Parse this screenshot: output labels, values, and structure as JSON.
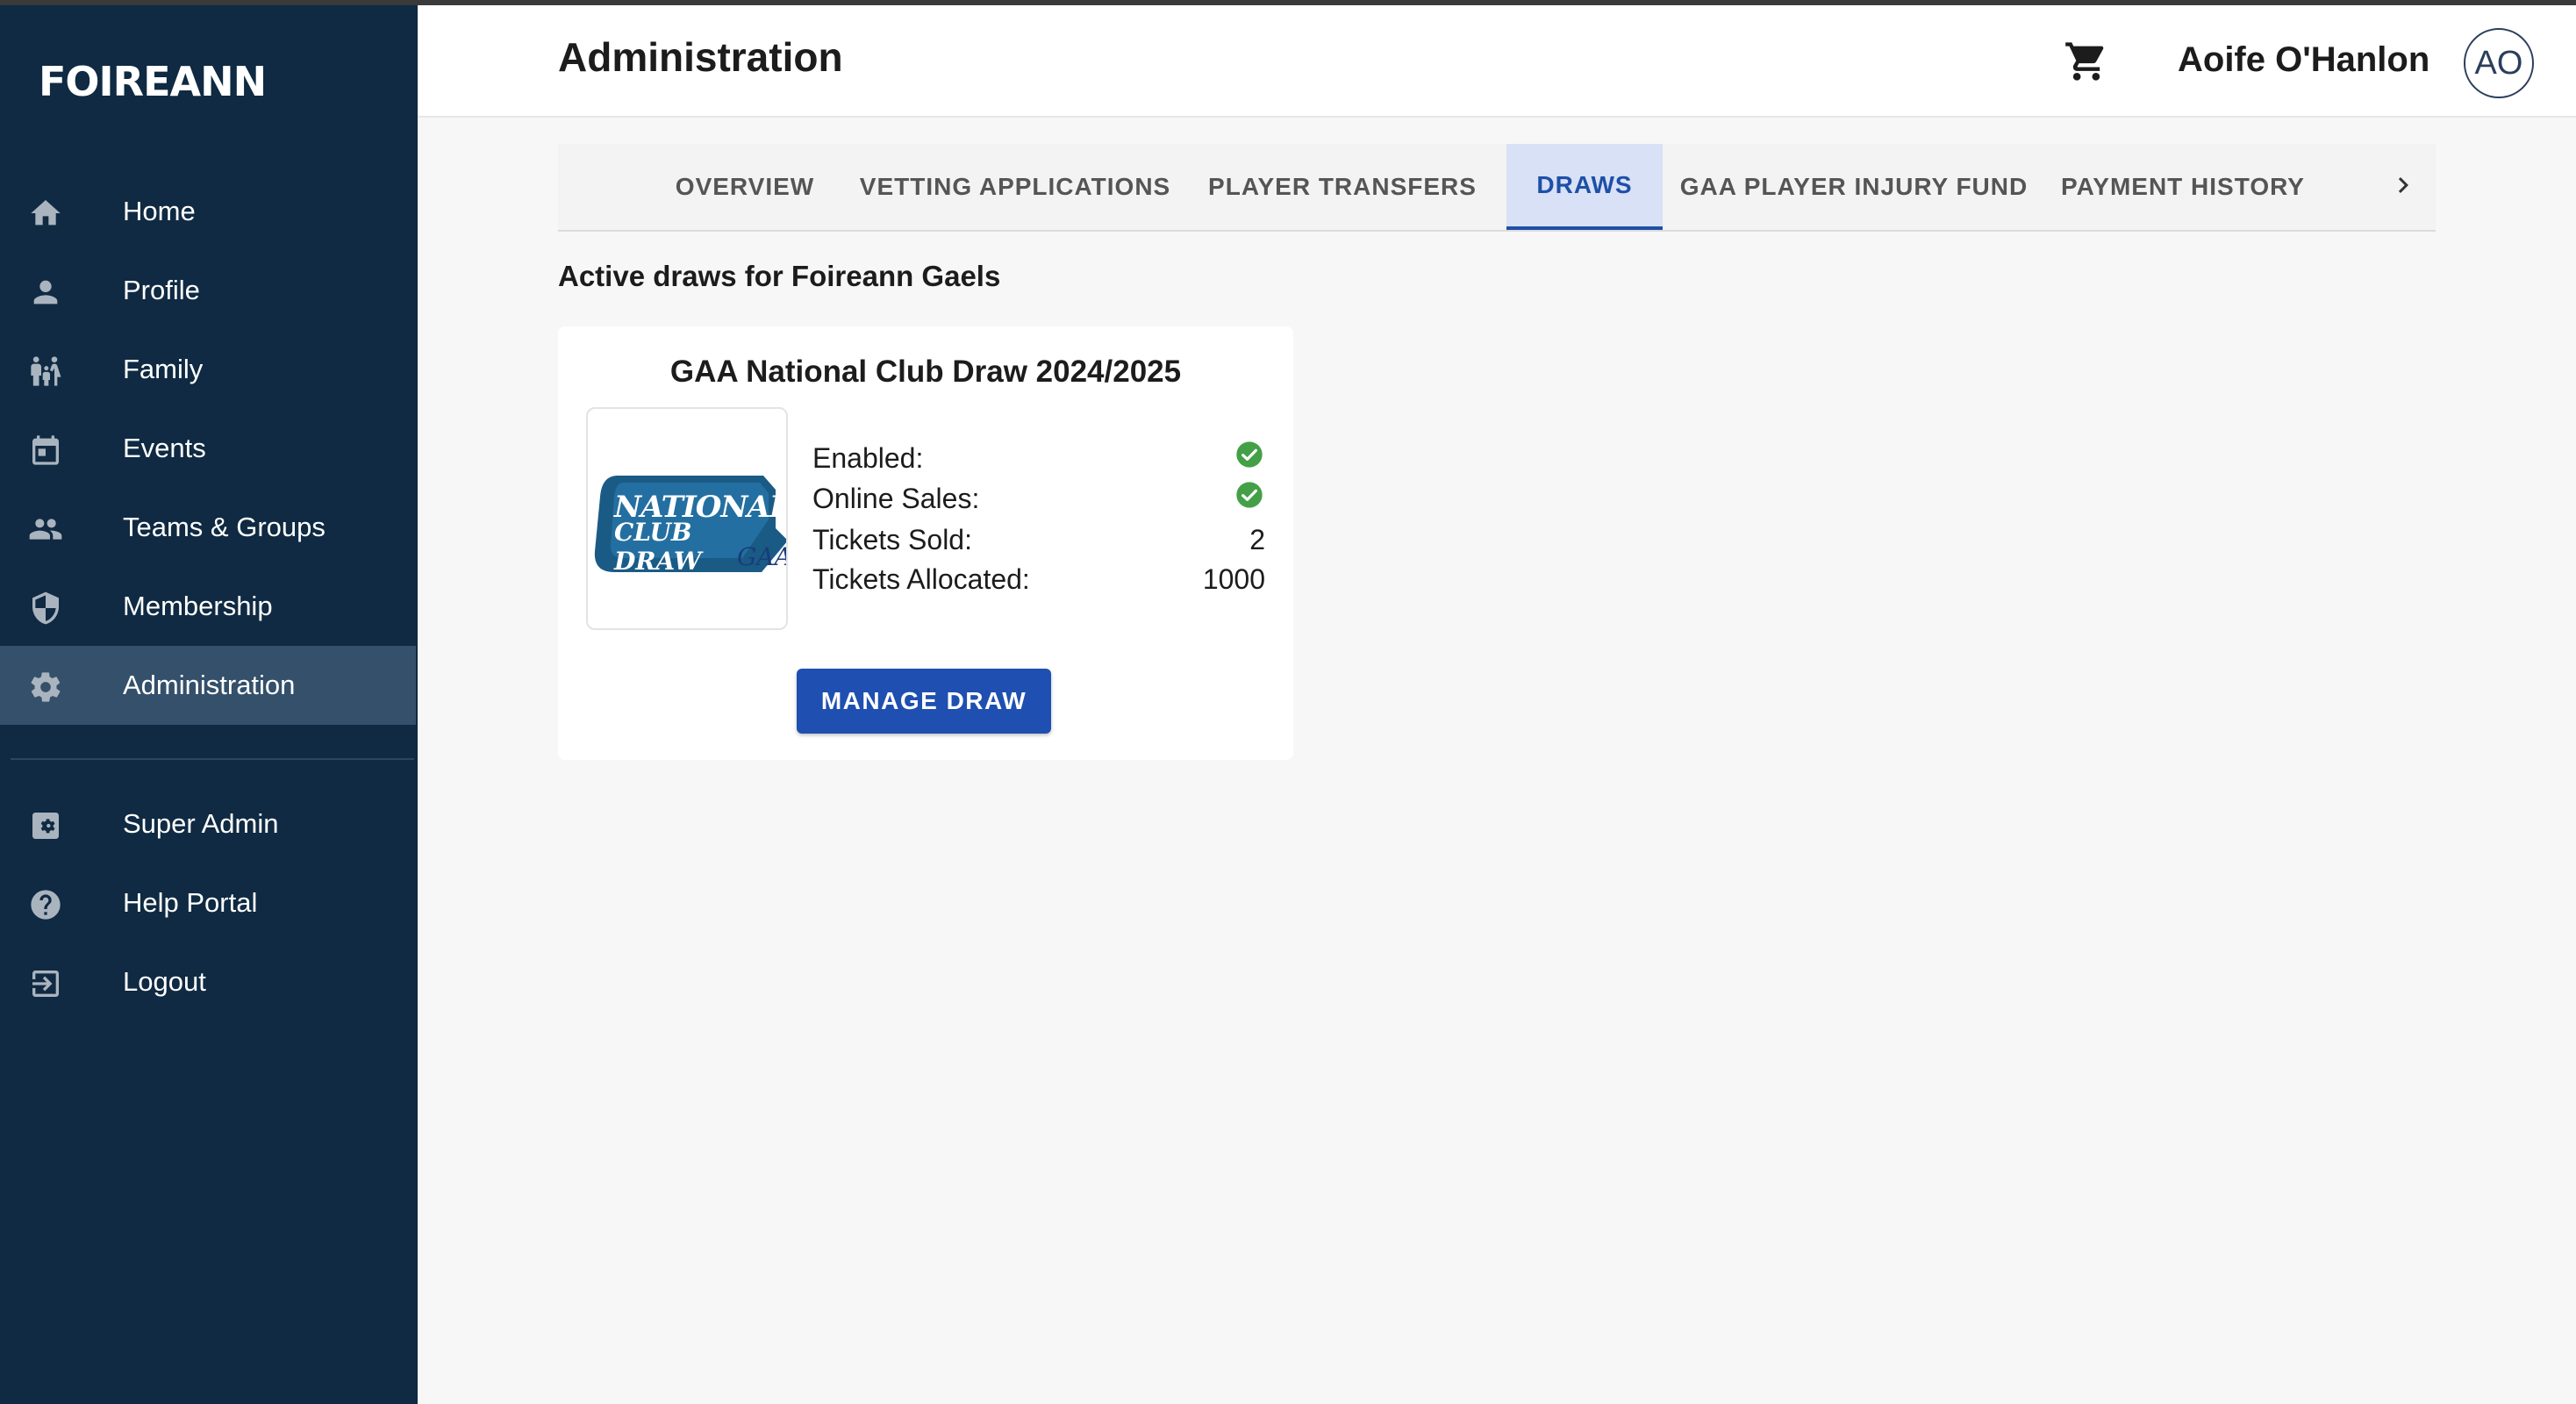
{
  "app": {
    "logo": "FOIREANN"
  },
  "sidebar": {
    "items": [
      {
        "label": "Home",
        "icon": "home-icon"
      },
      {
        "label": "Profile",
        "icon": "person-icon"
      },
      {
        "label": "Family",
        "icon": "family-icon"
      },
      {
        "label": "Events",
        "icon": "calendar-icon"
      },
      {
        "label": "Teams & Groups",
        "icon": "group-icon"
      },
      {
        "label": "Membership",
        "icon": "shield-icon"
      },
      {
        "label": "Administration",
        "icon": "gear-icon",
        "active": true
      }
    ],
    "secondary_items": [
      {
        "label": "Super Admin",
        "icon": "admin-settings-icon"
      },
      {
        "label": "Help Portal",
        "icon": "help-icon"
      },
      {
        "label": "Logout",
        "icon": "logout-icon"
      }
    ]
  },
  "header": {
    "title": "Administration",
    "cart_icon": "cart-icon",
    "user_name": "Aoife O'Hanlon",
    "avatar_initials": "AO"
  },
  "tabs": [
    {
      "label": "OVERVIEW"
    },
    {
      "label": "VETTING APPLICATIONS"
    },
    {
      "label": "PLAYER TRANSFERS"
    },
    {
      "label": "DRAWS",
      "active": true
    },
    {
      "label": "GAA PLAYER INJURY FUND"
    },
    {
      "label": "PAYMENT HISTORY"
    }
  ],
  "main": {
    "section_title": "Active draws for Foireann Gaels",
    "draw": {
      "title": "GAA National Club Draw 2024/2025",
      "logo_text_line1": "NATIONAL",
      "logo_text_line2": "CLUB DRAW",
      "logo_text_brand": "GAA",
      "stats": {
        "enabled_label": "Enabled:",
        "enabled": true,
        "online_sales_label": "Online Sales:",
        "online_sales": true,
        "tickets_sold_label": "Tickets Sold:",
        "tickets_sold": "2",
        "tickets_allocated_label": "Tickets Allocated:",
        "tickets_allocated": "1000"
      },
      "manage_button": "MANAGE DRAW"
    }
  },
  "colors": {
    "sidebar_bg": "#0f2a42",
    "sidebar_active": "#34506a",
    "accent": "#1f4fb0",
    "tab_active_bg": "#d8e1f5",
    "check_green": "#43a047"
  }
}
